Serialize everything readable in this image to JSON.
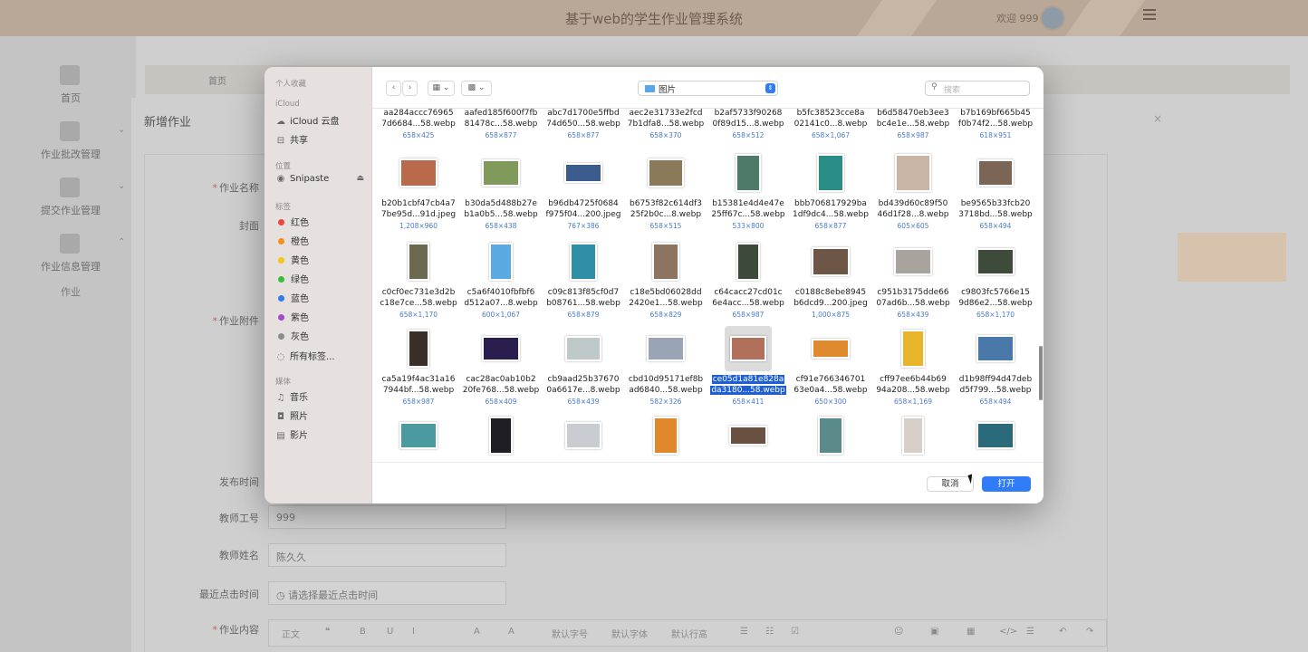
{
  "app": {
    "title": "基于web的学生作业管理系统",
    "user_greeting": "欢迎 999"
  },
  "nav": {
    "items": [
      {
        "label": "首页",
        "icon": "home-icon"
      },
      {
        "label": "作业批改管理",
        "icon": "chip-icon"
      },
      {
        "label": "提交作业管理",
        "icon": "chart-icon"
      },
      {
        "label": "作业信息管理",
        "icon": "grid-icon"
      }
    ],
    "sub_label": "作业"
  },
  "breadcrumb": {
    "home": "首页"
  },
  "form": {
    "title": "新增作业",
    "labels": {
      "name": "作业名称",
      "cover": "封面",
      "attachment": "作业附件",
      "publish_time": "发布时间",
      "teacher_id": "教师工号",
      "teacher_name": "教师姓名",
      "last_click": "最近点击时间",
      "content": "作业内容"
    },
    "values": {
      "teacher_id": "999",
      "teacher_name": "陈久久"
    },
    "placeholders": {
      "last_click": "请选择最近点击时间"
    },
    "editor_toolbar": [
      "正文",
      "默认字号",
      "默认字体",
      "默认行高"
    ]
  },
  "dialog": {
    "sidebar": {
      "favorites_title": "个人收藏",
      "icloud_title": "iCloud",
      "icloud_items": [
        "iCloud 云盘",
        "共享"
      ],
      "locations_title": "位置",
      "locations_items": [
        "Snipaste"
      ],
      "tags_title": "标签",
      "tags": [
        {
          "label": "红色",
          "color": "#f0443e"
        },
        {
          "label": "橙色",
          "color": "#f5901c"
        },
        {
          "label": "黄色",
          "color": "#f4c51b"
        },
        {
          "label": "绿色",
          "color": "#33c13d"
        },
        {
          "label": "蓝色",
          "color": "#3579f2"
        },
        {
          "label": "紫色",
          "color": "#a24bd0"
        },
        {
          "label": "灰色",
          "color": "#8d8d8d"
        }
      ],
      "all_tags": "所有标签...",
      "media_title": "媒体",
      "media_items": [
        "音乐",
        "照片",
        "影片"
      ]
    },
    "path": "图片",
    "search_placeholder": "搜索",
    "files": [
      {
        "name1": "aa284accc76965",
        "name2": "7d6684...58.webp",
        "dims": "658×425"
      },
      {
        "name1": "aafed185f600f7fb",
        "name2": "81478c...58.webp",
        "dims": "658×877"
      },
      {
        "name1": "abc7d1700e5ffbd",
        "name2": "74d650...58.webp",
        "dims": "658×877"
      },
      {
        "name1": "aec2e31733e2fcd",
        "name2": "7b1dfa8...58.webp",
        "dims": "658×370"
      },
      {
        "name1": "b2af5733f90268",
        "name2": "0f89d15...8.webp",
        "dims": "658×512"
      },
      {
        "name1": "b5fc38523cce8a",
        "name2": "02141c0...8.webp",
        "dims": "658×1,067"
      },
      {
        "name1": "b6d58470eb3ee3",
        "name2": "bc4e1e...58.webp",
        "dims": "658×987"
      },
      {
        "name1": "b7b169bf665b45",
        "name2": "f0b74f2...58.webp",
        "dims": "618×951"
      },
      {
        "name1": "b20b1cbf47cb4a7",
        "name2": "7be95d...91d.jpeg",
        "dims": "1,208×960",
        "color": "#b86a4a"
      },
      {
        "name1": "b30da5d488b27e",
        "name2": "b1a0b5...58.webp",
        "dims": "658×438",
        "color": "#7f9a5a"
      },
      {
        "name1": "b96db4725f0684",
        "name2": "f975f04...200.jpeg",
        "dims": "767×386",
        "color": "#3b5c8c"
      },
      {
        "name1": "b6753f82c614df3",
        "name2": "25f2b0c...8.webp",
        "dims": "658×515",
        "color": "#8a7a5a"
      },
      {
        "name1": "b15381e4d4e47e",
        "name2": "25ff67c...58.webp",
        "dims": "533×800",
        "color": "#4e7a6a"
      },
      {
        "name1": "bbb706817929ba",
        "name2": "1df9dc4...58.webp",
        "dims": "658×877",
        "color": "#2a8c86"
      },
      {
        "name1": "bd439d60c89f50",
        "name2": "46d1f28...8.webp",
        "dims": "605×605",
        "color": "#c9b5a6"
      },
      {
        "name1": "be9565b33fcb20",
        "name2": "3718bd...58.webp",
        "dims": "658×494",
        "color": "#7b6656"
      },
      {
        "name1": "c0cf0ec731e3d2b",
        "name2": "c18e7ce...58.webp",
        "dims": "658×1,170",
        "color": "#6c6a4e"
      },
      {
        "name1": "c5a6f4010fbfbf6",
        "name2": "d512a07...8.webp",
        "dims": "600×1,067",
        "color": "#5aa9e0"
      },
      {
        "name1": "c09c813f85cf0d7",
        "name2": "b08761...58.webp",
        "dims": "658×879",
        "color": "#2f8fa5"
      },
      {
        "name1": "c18e5bd06028dd",
        "name2": "2420e1...58.webp",
        "dims": "658×829",
        "color": "#8c7460"
      },
      {
        "name1": "c64cacc27cd01c",
        "name2": "6e4acc...58.webp",
        "dims": "658×987",
        "color": "#3d4a3a"
      },
      {
        "name1": "c0188c8ebe8945",
        "name2": "b6dcd9...200.jpeg",
        "dims": "1,000×875",
        "color": "#6e5646"
      },
      {
        "name1": "c951b3175dde66",
        "name2": "07ad6b...58.webp",
        "dims": "658×439",
        "color": "#a8a39c"
      },
      {
        "name1": "c9803fc5766e15",
        "name2": "9d86e2...58.webp",
        "dims": "658×1,170",
        "color": "#3e4a3a"
      },
      {
        "name1": "ca5a19f4ac31a16",
        "name2": "7944bf...58.webp",
        "dims": "658×987",
        "color": "#3a2e28"
      },
      {
        "name1": "cac28ac0ab10b2",
        "name2": "20fe768...58.webp",
        "dims": "658×409",
        "color": "#2a1e4e"
      },
      {
        "name1": "cb9aad25b37670",
        "name2": "0a6617e...8.webp",
        "dims": "658×439",
        "color": "#bfc9c9"
      },
      {
        "name1": "cbd10d95171ef8b",
        "name2": "ad6840...58.webp",
        "dims": "582×326",
        "color": "#9aa4b4"
      },
      {
        "name1": "ce05d1a81e828a",
        "name2": "da3180...58.webp",
        "dims": "658×411",
        "color": "#b0705a",
        "selected": true
      },
      {
        "name1": "cf91e766346701",
        "name2": "63e0a4...58.webp",
        "dims": "650×300",
        "color": "#e08a30"
      },
      {
        "name1": "cff97ee6b44b69",
        "name2": "94a208...58.webp",
        "dims": "658×1,169",
        "color": "#e8b52a"
      },
      {
        "name1": "d1b98ff94d47deb",
        "name2": "d5f799...58.webp",
        "dims": "658×494",
        "color": "#4a78a8"
      },
      {
        "name1": "",
        "name2": "",
        "dims": "",
        "color": "#4a9aa0"
      },
      {
        "name1": "",
        "name2": "",
        "dims": "",
        "color": "#1e1e24"
      },
      {
        "name1": "",
        "name2": "",
        "dims": "",
        "color": "#c9ccd0"
      },
      {
        "name1": "",
        "name2": "",
        "dims": "",
        "color": "#e0892a"
      },
      {
        "name1": "",
        "name2": "",
        "dims": "",
        "color": "#6a5040"
      },
      {
        "name1": "",
        "name2": "",
        "dims": "",
        "color": "#5a8a8a"
      },
      {
        "name1": "",
        "name2": "",
        "dims": "",
        "color": "#d8cfc8"
      },
      {
        "name1": "",
        "name2": "",
        "dims": "",
        "color": "#2a6a7a"
      }
    ],
    "buttons": {
      "cancel": "取消",
      "open": "打开"
    }
  }
}
